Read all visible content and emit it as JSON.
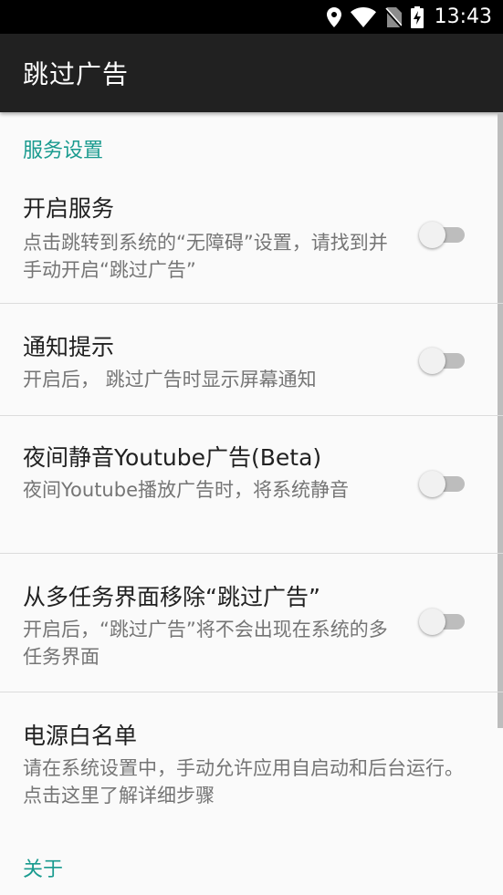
{
  "status_bar": {
    "time": "13:43",
    "icons": [
      "location-icon",
      "wifi-icon",
      "no-sim-icon",
      "battery-charging-icon"
    ]
  },
  "toolbar": {
    "title": "跳过广告"
  },
  "categories": {
    "service": "服务设置",
    "about": "关于"
  },
  "prefs": [
    {
      "title": "开启服务",
      "summary": "点击跳转到系统的“无障碍”设置，请找到并手动开启“跳过广告”",
      "switch": false
    },
    {
      "title": "通知提示",
      "summary": "开启后， 跳过广告时显示屏幕通知",
      "switch": false
    },
    {
      "title": "夜间静音Youtube广告(Beta)",
      "summary": "夜间Youtube播放广告时，将系统静音",
      "switch": false
    },
    {
      "title": "从多任务界面移除“跳过广告”",
      "summary": "开启后，“跳过广告”将不会出现在系统的多任务界面",
      "switch": false
    },
    {
      "title": "电源白名单",
      "summary": "请在系统设置中，手动允许应用自启动和后台运行。点击这里了解详细步骤"
    }
  ],
  "colors": {
    "accent": "#1a9b8f",
    "toolbar": "#212121",
    "background": "#fafafa"
  }
}
